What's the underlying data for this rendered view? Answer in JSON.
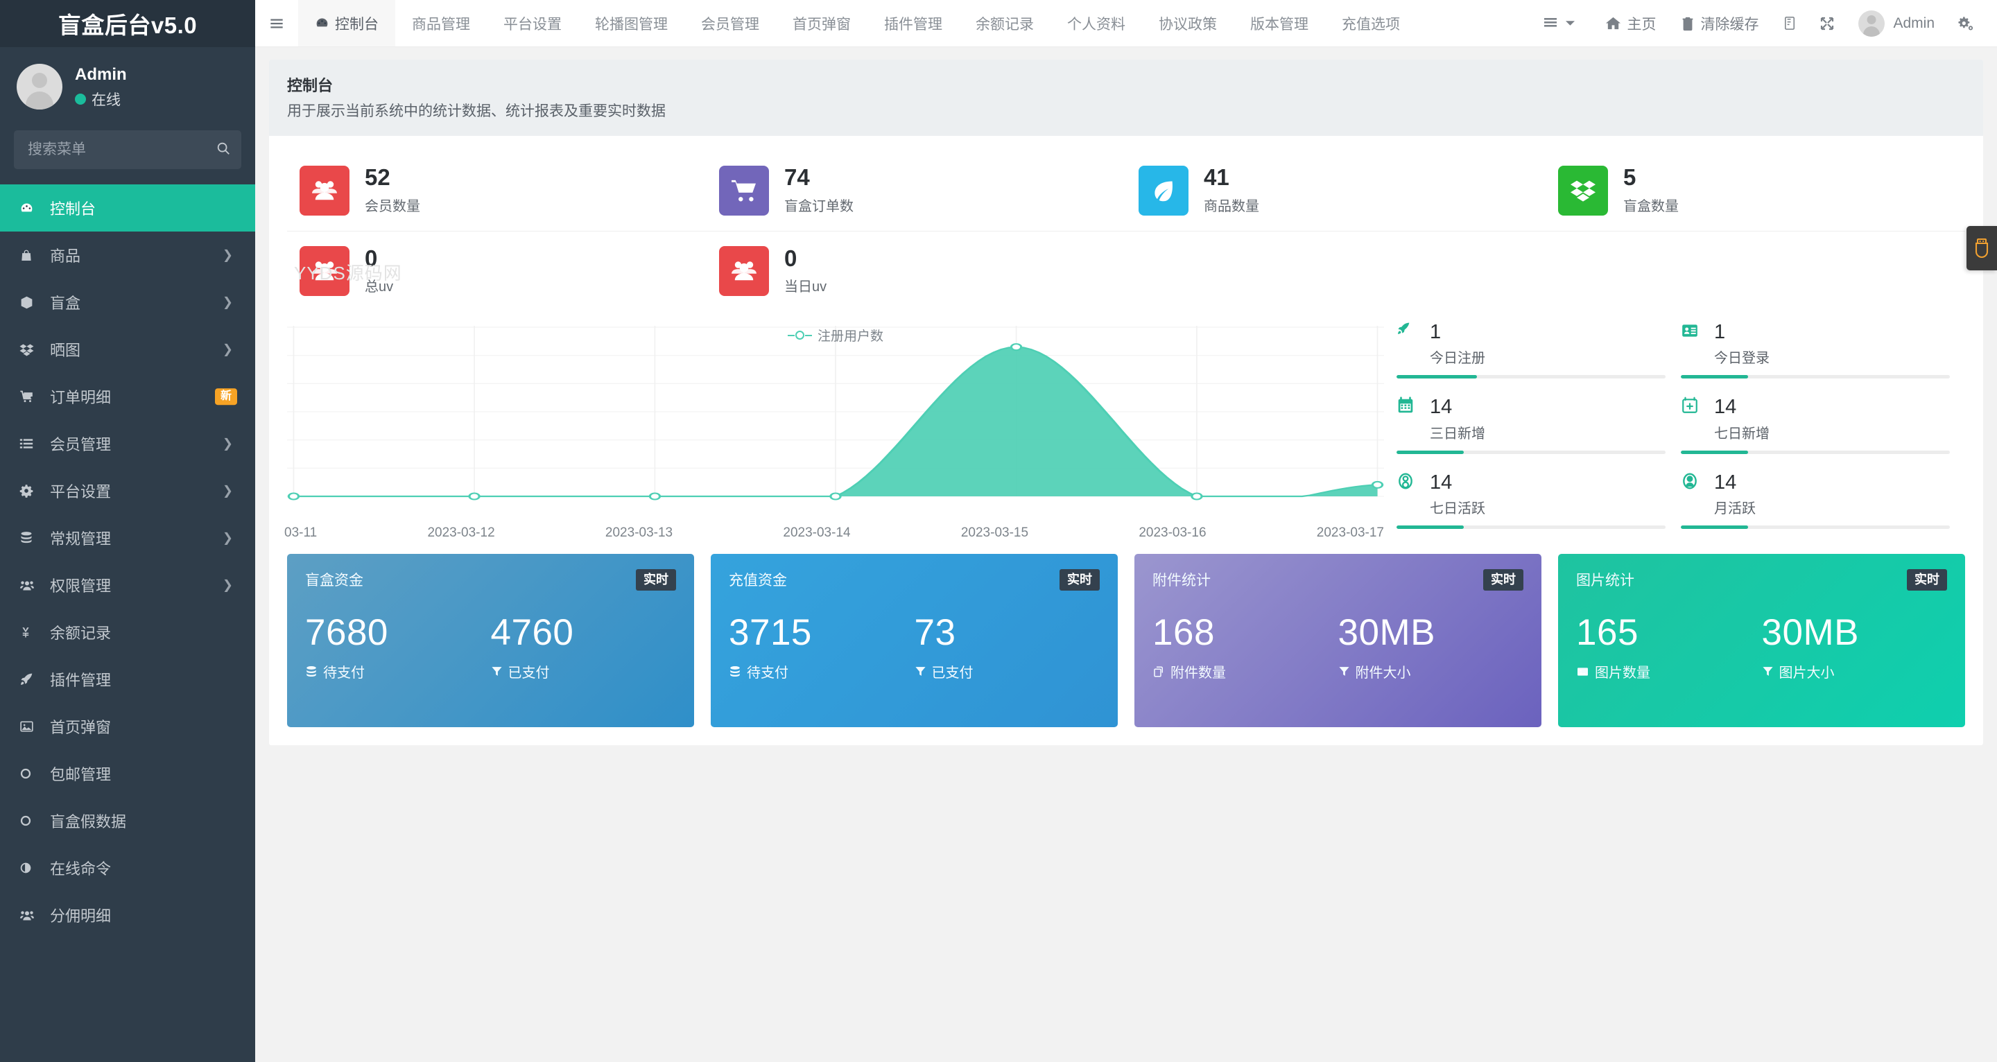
{
  "sidebar": {
    "logo": "盲盒后台v5.0",
    "profile": {
      "name": "Admin",
      "status": "在线"
    },
    "search": {
      "placeholder": "搜索菜单",
      "value": ""
    },
    "items": [
      {
        "label": "控制台",
        "icon": "dashboard-icon",
        "active": true,
        "caret": false,
        "badge": ""
      },
      {
        "label": "商品",
        "icon": "bag-icon",
        "active": false,
        "caret": true,
        "badge": ""
      },
      {
        "label": "盲盒",
        "icon": "box-icon",
        "active": false,
        "caret": true,
        "badge": ""
      },
      {
        "label": "晒图",
        "icon": "dropbox-icon",
        "active": false,
        "caret": true,
        "badge": ""
      },
      {
        "label": "订单明细",
        "icon": "cart-icon",
        "active": false,
        "caret": false,
        "badge": "新"
      },
      {
        "label": "会员管理",
        "icon": "list-icon",
        "active": false,
        "caret": true,
        "badge": ""
      },
      {
        "label": "平台设置",
        "icon": "gear-icon",
        "active": false,
        "caret": true,
        "badge": ""
      },
      {
        "label": "常规管理",
        "icon": "database-icon",
        "active": false,
        "caret": true,
        "badge": ""
      },
      {
        "label": "权限管理",
        "icon": "users-icon",
        "active": false,
        "caret": true,
        "badge": ""
      },
      {
        "label": "余额记录",
        "icon": "yen-icon",
        "active": false,
        "caret": false,
        "badge": ""
      },
      {
        "label": "插件管理",
        "icon": "rocket-icon",
        "active": false,
        "caret": false,
        "badge": ""
      },
      {
        "label": "首页弹窗",
        "icon": "image-icon",
        "active": false,
        "caret": false,
        "badge": ""
      },
      {
        "label": "包邮管理",
        "icon": "circle-icon",
        "active": false,
        "caret": false,
        "badge": ""
      },
      {
        "label": "盲盒假数据",
        "icon": "circle-icon",
        "active": false,
        "caret": false,
        "badge": ""
      },
      {
        "label": "在线命令",
        "icon": "halfcircle-icon",
        "active": false,
        "caret": false,
        "badge": ""
      },
      {
        "label": "分佣明细",
        "icon": "users-icon",
        "active": false,
        "caret": false,
        "badge": ""
      }
    ]
  },
  "topbar": {
    "hamburger": "hamburger-icon",
    "tabs": [
      {
        "label": "控制台",
        "active": true
      },
      {
        "label": "商品管理",
        "active": false
      },
      {
        "label": "平台设置",
        "active": false
      },
      {
        "label": "轮播图管理",
        "active": false
      },
      {
        "label": "会员管理",
        "active": false
      },
      {
        "label": "首页弹窗",
        "active": false
      },
      {
        "label": "插件管理",
        "active": false
      },
      {
        "label": "余额记录",
        "active": false
      },
      {
        "label": "个人资料",
        "active": false
      },
      {
        "label": "协议政策",
        "active": false
      },
      {
        "label": "版本管理",
        "active": false
      },
      {
        "label": "充值选项",
        "active": false
      }
    ],
    "menu_toggle": "list-menu-icon",
    "home_label": "主页",
    "clear_cache_label": "清除缓存",
    "theme_icon": "theme-icon",
    "fullscreen_icon": "fullscreen-icon",
    "user_label": "Admin",
    "settings_icon": "gears-icon"
  },
  "page": {
    "title": "控制台",
    "subtitle": "用于展示当前系统中的统计数据、统计报表及重要实时数据",
    "watermark": "YYDS源码网"
  },
  "stats": [
    {
      "value": "52",
      "label": "会员数量",
      "color": "#e9484a",
      "icon": "group-icon"
    },
    {
      "value": "74",
      "label": "盲盒订单数",
      "color": "#7266ba",
      "icon": "cart-icon"
    },
    {
      "value": "41",
      "label": "商品数量",
      "color": "#27b7e8",
      "icon": "leaf-icon"
    },
    {
      "value": "5",
      "label": "盲盒数量",
      "color": "#2ab934",
      "icon": "dropbox-icon"
    },
    {
      "value": "0",
      "label": "总uv",
      "color": "#e9484a",
      "icon": "group-icon"
    },
    {
      "value": "0",
      "label": "当日uv",
      "color": "#e9484a",
      "icon": "group-icon"
    }
  ],
  "chart_data": {
    "type": "area",
    "title": "",
    "legend": [
      "注册用户数"
    ],
    "legend_position": "top-center",
    "xlabel": "",
    "ylabel": "",
    "grid": true,
    "categories": [
      "03-11",
      "2023-03-12",
      "2023-03-13",
      "2023-03-14",
      "2023-03-15",
      "2023-03-16",
      "2023-03-17"
    ],
    "series": [
      {
        "name": "注册用户数",
        "values": [
          0,
          0,
          0,
          0,
          13,
          0,
          1
        ],
        "color": "#4ecfb4"
      }
    ],
    "ylim": [
      0,
      14
    ]
  },
  "side_stats": [
    {
      "value": "1",
      "label": "今日注册",
      "icon": "rocket-icon",
      "progress": 30
    },
    {
      "value": "1",
      "label": "今日登录",
      "icon": "idcard-icon",
      "progress": 25
    },
    {
      "value": "14",
      "label": "三日新增",
      "icon": "calendar-icon",
      "progress": 25
    },
    {
      "value": "14",
      "label": "七日新增",
      "icon": "calplus-icon",
      "progress": 25
    },
    {
      "value": "14",
      "label": "七日活跃",
      "icon": "user-circle-icon",
      "progress": 25
    },
    {
      "value": "14",
      "label": "月活跃",
      "icon": "user-circle-solid-icon",
      "progress": 25
    }
  ],
  "money_cards": [
    {
      "title": "盲盒资金",
      "badge": "实时",
      "left_value": "7680",
      "left_label": "待支付",
      "left_icon": "database-icon",
      "right_value": "4760",
      "right_label": "已支付",
      "right_icon": "funnel-icon",
      "grad_from": "#5d9fc4",
      "grad_to": "#2f8fc9"
    },
    {
      "title": "充值资金",
      "badge": "实时",
      "left_value": "3715",
      "left_label": "待支付",
      "left_icon": "database-icon",
      "right_value": "73",
      "right_label": "已支付",
      "right_icon": "funnel-icon",
      "grad_from": "#35a3dd",
      "grad_to": "#2f93d4"
    },
    {
      "title": "附件统计",
      "badge": "实时",
      "left_value": "168",
      "left_label": "附件数量",
      "left_icon": "copy-icon",
      "right_value": "30MB",
      "right_label": "附件大小",
      "right_icon": "funnel-icon",
      "grad_from": "#9b96cf",
      "grad_to": "#6b62be"
    },
    {
      "title": "图片统计",
      "badge": "实时",
      "left_value": "165",
      "left_label": "图片数量",
      "left_icon": "image-icon",
      "right_value": "30MB",
      "right_label": "图片大小",
      "right_icon": "funnel-icon",
      "grad_from": "#1fc3a0",
      "grad_to": "#0fcfae"
    }
  ],
  "float_button": {
    "icon": "usb-plugin-icon",
    "color": "#f0a030"
  }
}
